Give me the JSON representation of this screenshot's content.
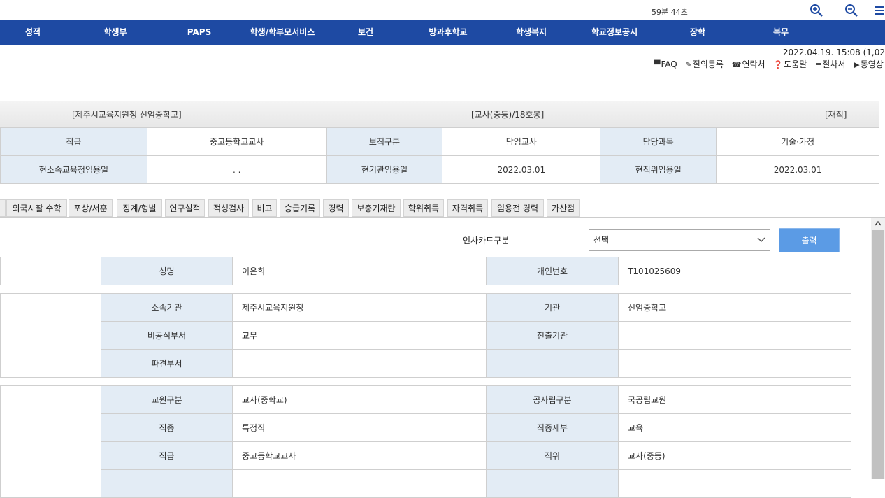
{
  "topbar": {
    "timer": "59분 44초"
  },
  "icons": {
    "zoom_in": "zoom-in-icon",
    "zoom_out": "zoom-out-icon",
    "menu": "hamburger-menu-icon"
  },
  "colors": {
    "nav_bg": "#1e4aa3",
    "header_cell": "#e3ecf5",
    "print_button": "#5b9be5"
  },
  "nav": [
    "성적",
    "학생부",
    "PAPS",
    "학생/학부모서비스",
    "보건",
    "방과후학교",
    "학생복지",
    "학교정보공시",
    "장학",
    "복무"
  ],
  "datetime": "2022.04.19. 15:08 (1,02",
  "quick_links": [
    "FAQ",
    "질의등록",
    "연락처",
    "도움말",
    "절차서",
    "동영상"
  ],
  "info": {
    "org": "[제주시교육지원청 신엄중학교]",
    "grade": "[교사(중등)/18호봉]",
    "status": "[재직]",
    "rows": [
      [
        "직급",
        "중고등학교교사",
        "보직구분",
        "담임교사",
        "담당과목",
        "기술·가정"
      ],
      [
        "현소속교육청임용일",
        ". .",
        "현기관임용일",
        "2022.03.01",
        "현직위임용일",
        "2022.03.01"
      ]
    ]
  },
  "tabs": [
    "외국시찰 수학",
    "포상/서훈",
    "징계/형벌",
    "연구실적",
    "적성검사",
    "비고",
    "승급기록",
    "경력",
    "보충기재란",
    "학위취득",
    "자격취득",
    "임용전 경력",
    "가산점"
  ],
  "form": {
    "select_label": "인사카드구분",
    "select_value": "선택",
    "print_label": "출력"
  },
  "personal": {
    "rows": [
      [
        "성명",
        "이은희",
        "개인번호",
        "T101025609"
      ]
    ]
  },
  "affiliation": {
    "rows": [
      [
        "소속기관",
        "제주시교육지원청",
        "기관",
        "신엄중학교"
      ],
      [
        "비공식부서",
        "교무",
        "전출기관",
        ""
      ],
      [
        "파견부서",
        "",
        "",
        ""
      ]
    ]
  },
  "position": {
    "rows": [
      [
        "교원구분",
        "교사(중학교)",
        "공사립구분",
        "국공립교원"
      ],
      [
        "직종",
        "특정직",
        "직종세부",
        "교육"
      ],
      [
        "직급",
        "중고등학교교사",
        "직위",
        "교사(중등)"
      ],
      [
        "",
        "",
        "",
        ""
      ]
    ]
  }
}
